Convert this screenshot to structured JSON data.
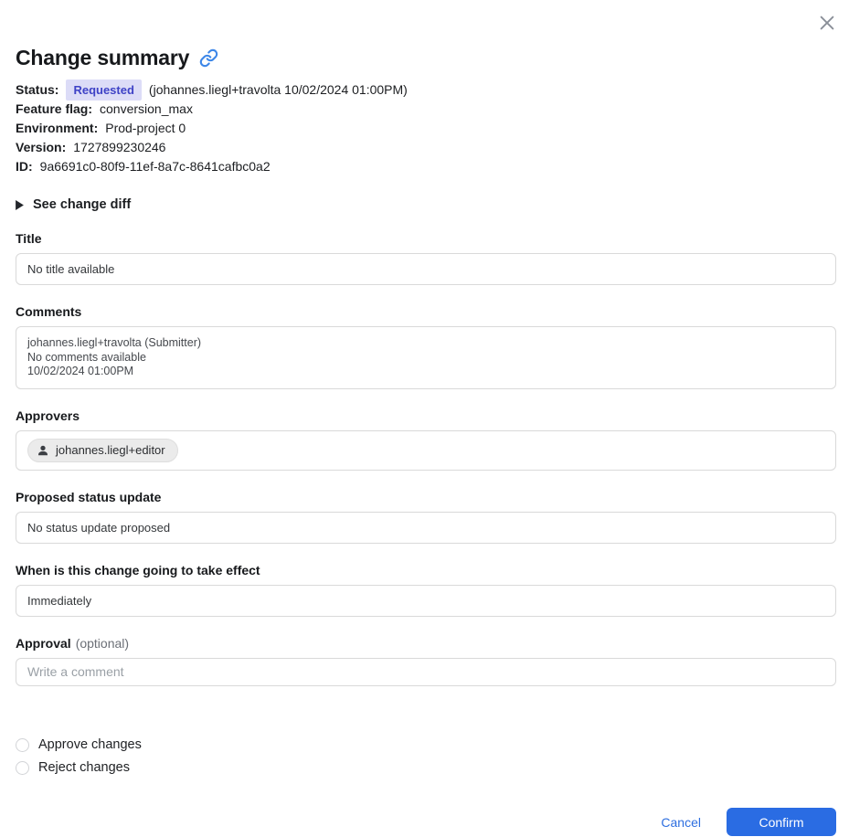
{
  "dialog": {
    "title": "Change summary"
  },
  "colors": {
    "confirm_blue": "#2a6ce3",
    "cancel_blue": "#2e6fe0",
    "link_icon_blue": "#3d87e8",
    "badge_bg": "#dcdcf7",
    "badge_text": "#3e42c6"
  },
  "meta": {
    "status": {
      "label": "Status:",
      "badge": "Requested",
      "suffix": "(johannes.liegl+travolta 10/02/2024 01:00PM)"
    },
    "rows": [
      {
        "label": "Feature flag:",
        "value": "conversion_max"
      },
      {
        "label": "Environment:",
        "value": "Prod-project 0"
      },
      {
        "label": "Version:",
        "value": "1727899230246"
      },
      {
        "label": "ID:",
        "value": "9a6691c0-80f9-11ef-8a7c-8641cafbc0a2"
      }
    ]
  },
  "diff_toggle": {
    "label": "See change diff"
  },
  "sections": {
    "title": {
      "label": "Title",
      "value": "No title available"
    },
    "comments": {
      "label": "Comments",
      "lines": [
        "johannes.liegl+travolta (Submitter)",
        "No comments available",
        "10/02/2024 01:00PM"
      ]
    },
    "approvers": {
      "label": "Approvers",
      "chip": "johannes.liegl+editor"
    },
    "proposed_status": {
      "label": "Proposed status update",
      "value": "No status update proposed"
    },
    "effect": {
      "label": "When is this change going to take effect",
      "value": "Immediately"
    },
    "approval": {
      "label": "Approval",
      "optional_hint": "(optional)",
      "placeholder": "Write a comment"
    }
  },
  "decision": {
    "options": [
      {
        "label": "Approve changes"
      },
      {
        "label": "Reject changes"
      }
    ]
  },
  "footer": {
    "cancel": "Cancel",
    "confirm": "Confirm"
  }
}
